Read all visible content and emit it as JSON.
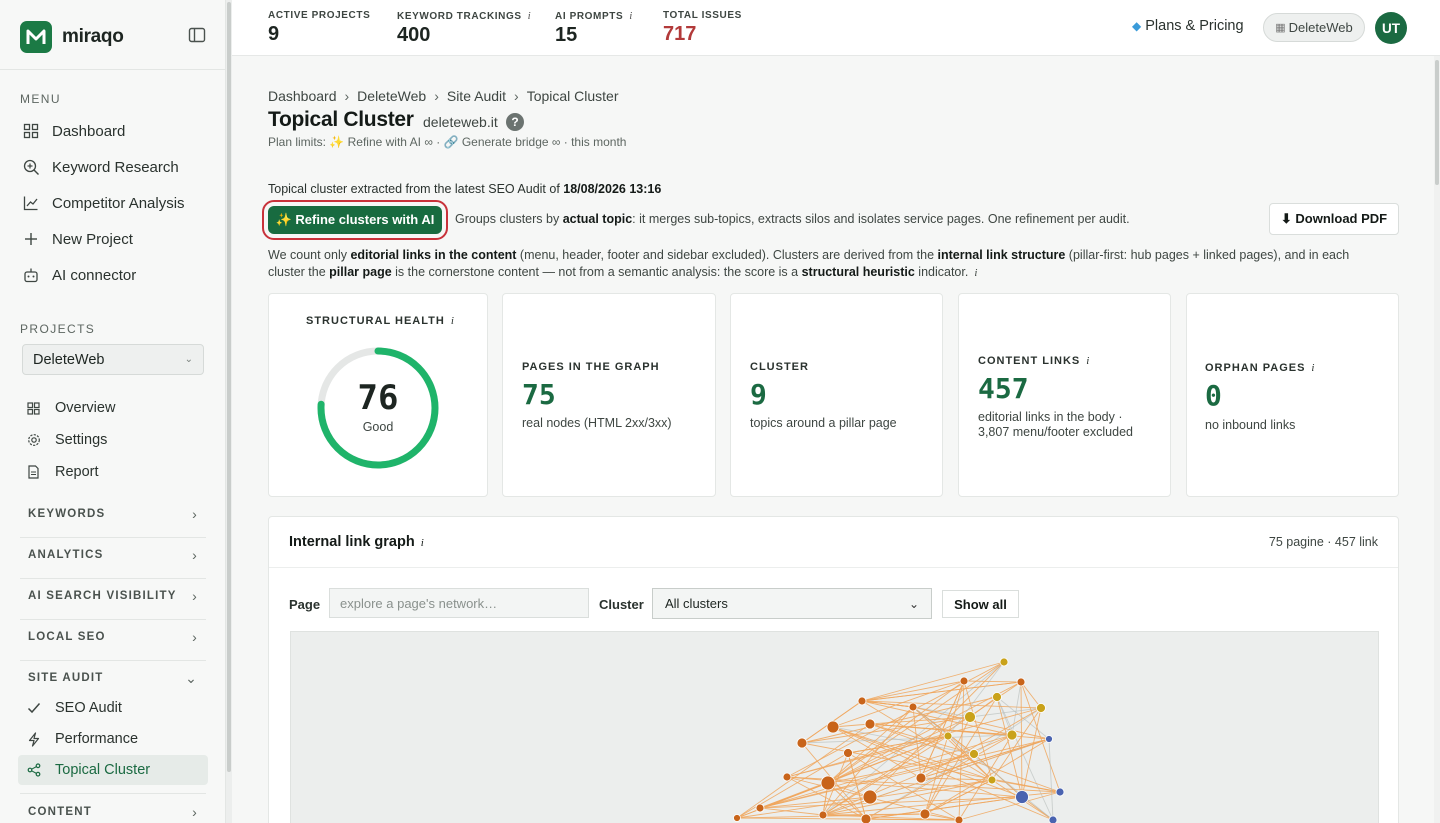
{
  "brand": {
    "name": "miraqo"
  },
  "sidebar": {
    "menu_label": "MENU",
    "menu": [
      {
        "label": "Dashboard",
        "icon": "grid-icon"
      },
      {
        "label": "Keyword Research",
        "icon": "magnifier-plus-icon"
      },
      {
        "label": "Competitor Analysis",
        "icon": "line-chart-icon"
      },
      {
        "label": "New Project",
        "icon": "plus-icon"
      },
      {
        "label": "AI connector",
        "icon": "robot-icon"
      }
    ],
    "projects_label": "PROJECTS",
    "project_selected": "DeleteWeb",
    "project_menu": [
      {
        "label": "Overview",
        "icon": "grid-icon"
      },
      {
        "label": "Settings",
        "icon": "gear-icon"
      },
      {
        "label": "Report",
        "icon": "document-icon"
      }
    ],
    "groups": [
      "KEYWORDS",
      "ANALYTICS",
      "AI SEARCH VISIBILITY",
      "LOCAL SEO",
      "SITE AUDIT"
    ],
    "site_audit_items": [
      {
        "label": "SEO Audit",
        "icon": "check-icon"
      },
      {
        "label": "Performance",
        "icon": "lightning-icon"
      },
      {
        "label": "Topical Cluster",
        "icon": "share-nodes-icon"
      }
    ],
    "content_group": "CONTENT"
  },
  "topbar": {
    "stats": [
      {
        "label": "ACTIVE PROJECTS",
        "value": "9",
        "info": ""
      },
      {
        "label": "KEYWORD TRACKINGS",
        "value": "400",
        "info": "i"
      },
      {
        "label": "AI PROMPTS",
        "value": "15",
        "info": "i"
      },
      {
        "label": "TOTAL ISSUES",
        "value": "717",
        "info": ""
      }
    ],
    "plans": "Plans & Pricing",
    "project_pill": "DeleteWeb",
    "avatar": "UT"
  },
  "breadcrumb": [
    "Dashboard",
    "DeleteWeb",
    "Site Audit",
    "Topical Cluster"
  ],
  "page": {
    "title": "Topical Cluster",
    "domain": "deleteweb.it",
    "help": "?",
    "plan_limits": "Plan limits: ✨ Refine with AI ∞ · 🔗 Generate bridge ∞ · this month",
    "extracted_prefix": "Topical cluster extracted from the latest SEO Audit of ",
    "extracted_date": "18/08/2026 13:16",
    "refine_button": "✨ Refine clusters with AI",
    "refine_desc_1": "Groups clusters by ",
    "refine_desc_b": "actual topic",
    "refine_desc_2": ": it merges sub-topics, extracts silos and isolates service pages. One refinement per audit.",
    "download_button": "⬇ Download PDF",
    "note": {
      "t1": "We count only ",
      "b1": "editorial links in the content",
      "t2": " (menu, header, footer and sidebar excluded). Clusters are derived from the ",
      "b2": "internal link structure",
      "t3": " (pillar-first: hub pages + linked pages), and in each cluster the ",
      "b3": "pillar page",
      "t4": " is the cornerstone content — not from a semantic analysis: the score is a ",
      "b4": "structural heuristic",
      "t5": " indicator."
    }
  },
  "cards": {
    "health": {
      "label": "STRUCTURAL HEALTH",
      "value": "76",
      "grade": "Good",
      "score_fraction": 0.76
    },
    "pages": {
      "label": "PAGES IN THE GRAPH",
      "value": "75",
      "sub": "real nodes (HTML 2xx/3xx)"
    },
    "cluster": {
      "label": "CLUSTER",
      "value": "9",
      "sub": "topics around a pillar page"
    },
    "links": {
      "label": "CONTENT LINKS",
      "value": "457",
      "sub1": "editorial links in the body ·",
      "sub2": "3,807 menu/footer excluded"
    },
    "orphan": {
      "label": "ORPHAN PAGES",
      "value": "0",
      "sub": "no inbound links"
    }
  },
  "graph": {
    "title": "Internal link graph",
    "count": "75 pagine · 457 link",
    "page_label": "Page",
    "page_placeholder": "explore a page's network…",
    "cluster_label": "Cluster",
    "cluster_value": "All clusters",
    "show_all": "Show all",
    "colors": {
      "orange": "#c8641a",
      "gold": "#c9a21a",
      "blue": "#4a63b0",
      "edge_orange": "#f0a65c",
      "edge_gray": "#b4bab7"
    }
  }
}
